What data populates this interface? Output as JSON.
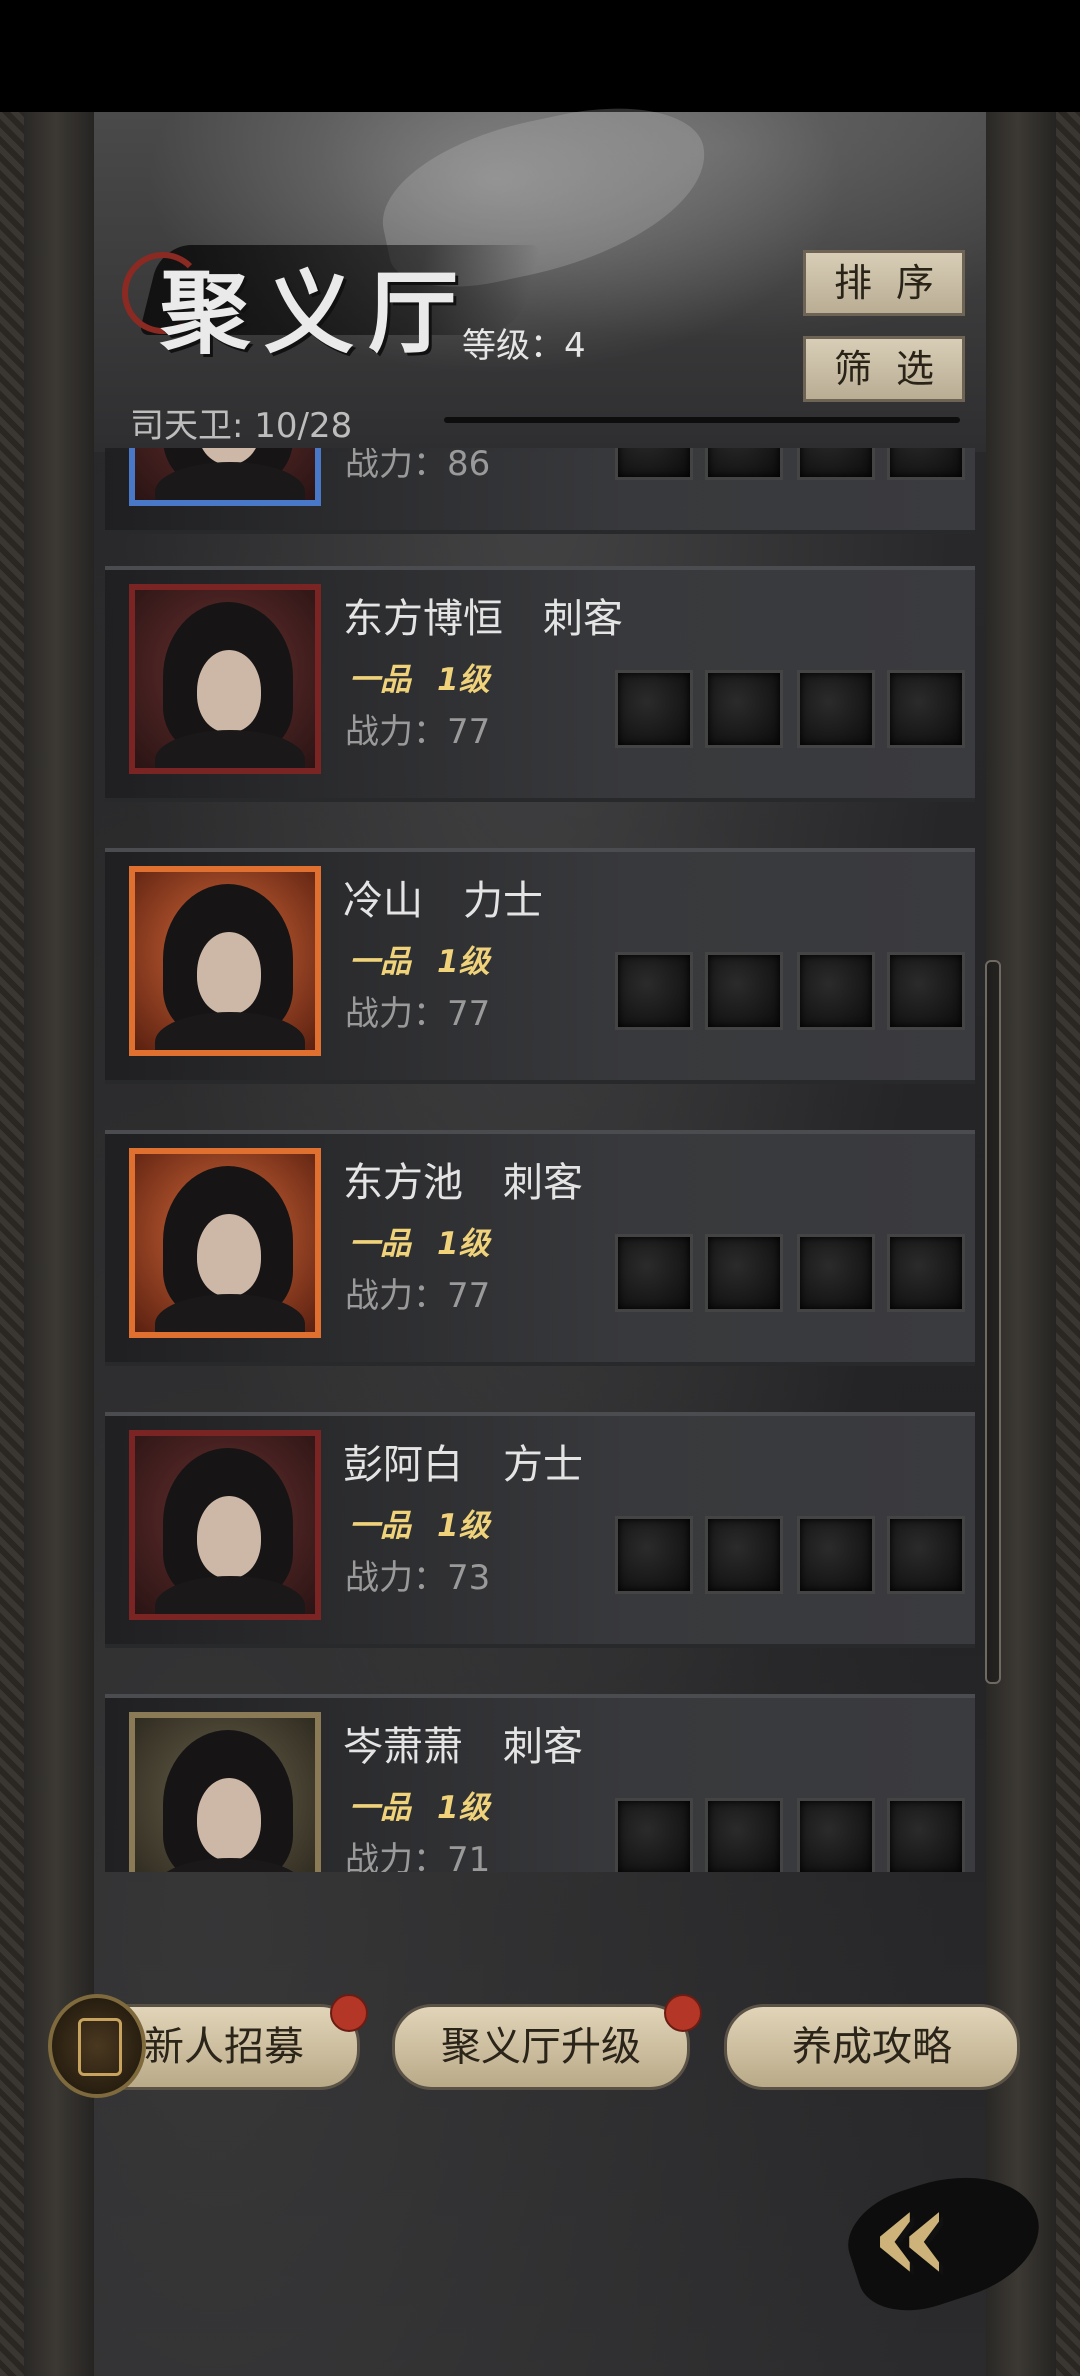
{
  "hall": {
    "title": "聚义厅",
    "level_text": "等级：4",
    "roster_count": "司天卫: 10/28",
    "sort_label": "排序",
    "filter_label": "筛选"
  },
  "partial_top": {
    "power": "战力：86"
  },
  "heroes": [
    {
      "name": "东方博恒　刺客",
      "grade": "一品",
      "level": "1级",
      "power": "战力：77"
    },
    {
      "name": "冷山　力士",
      "grade": "一品",
      "level": "1级",
      "power": "战力：77"
    },
    {
      "name": "东方池　刺客",
      "grade": "一品",
      "level": "1级",
      "power": "战力：77"
    },
    {
      "name": "彭阿白　方士",
      "grade": "一品",
      "level": "1级",
      "power": "战力：73"
    },
    {
      "name": "岑萧萧　刺客",
      "grade": "一品",
      "level": "1级",
      "power": "战力：71"
    }
  ],
  "bottom": {
    "recruit_label": "新人招募",
    "upgrade_label": "聚义厅升级",
    "guide_label": "养成攻略",
    "back_icon": "double-chevron-left-icon"
  },
  "colors": {
    "accent_gold": "#efd27a",
    "badge_red": "#b33626",
    "button_parchment": "#d8cdb6"
  }
}
